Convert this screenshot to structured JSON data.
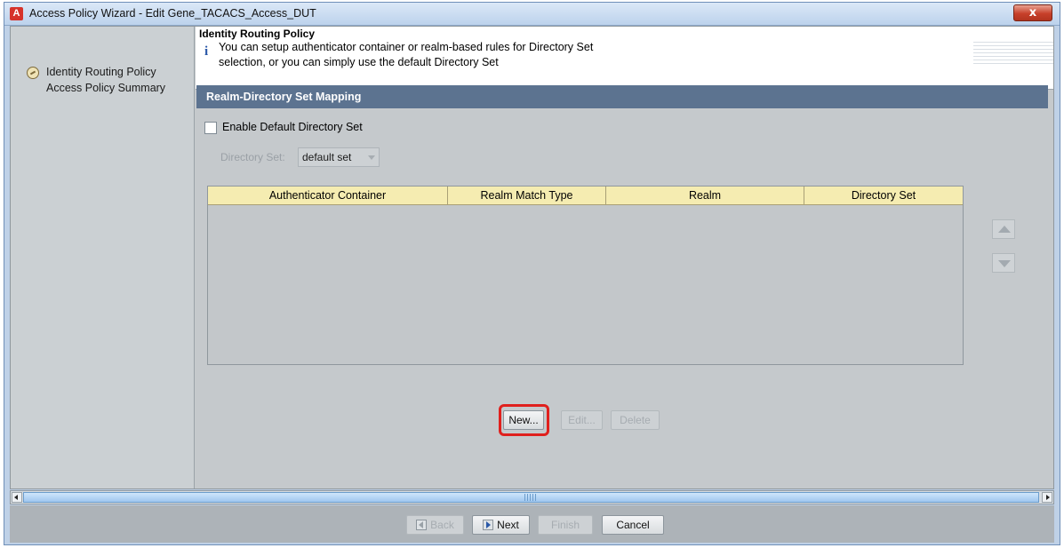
{
  "window": {
    "app_icon_letter": "A",
    "title": "Access Policy Wizard - Edit Gene_TACACS_Access_DUT",
    "close_label": "x"
  },
  "sidebar": {
    "items": [
      {
        "label": "Identity Routing Policy",
        "icon": "step-current-icon"
      },
      {
        "label": "Access Policy Summary"
      }
    ]
  },
  "header": {
    "title": "Identity Routing Policy",
    "info_icon_glyph": "i",
    "description_line1": "You can setup authenticator container or realm-based rules for Directory Set",
    "description_line2": "selection, or you can simply use the default Directory Set"
  },
  "section": {
    "title": "Realm-Directory Set Mapping"
  },
  "default_set": {
    "checkbox_label": "Enable Default Directory Set",
    "checked": false,
    "directory_set_label": "Directory Set:",
    "directory_set_value": "default set"
  },
  "table": {
    "columns": [
      "Authenticator Container",
      "Realm Match Type",
      "Realm",
      "Directory Set"
    ],
    "rows": []
  },
  "row_buttons": {
    "new_label": "New...",
    "edit_label": "Edit...",
    "delete_label": "Delete"
  },
  "footer": {
    "back_label": "Back",
    "next_label": "Next",
    "finish_label": "Finish",
    "cancel_label": "Cancel"
  },
  "colors": {
    "section_bar": "#5c7390",
    "table_header": "#f5ecb1",
    "highlight": "#e0201d"
  }
}
